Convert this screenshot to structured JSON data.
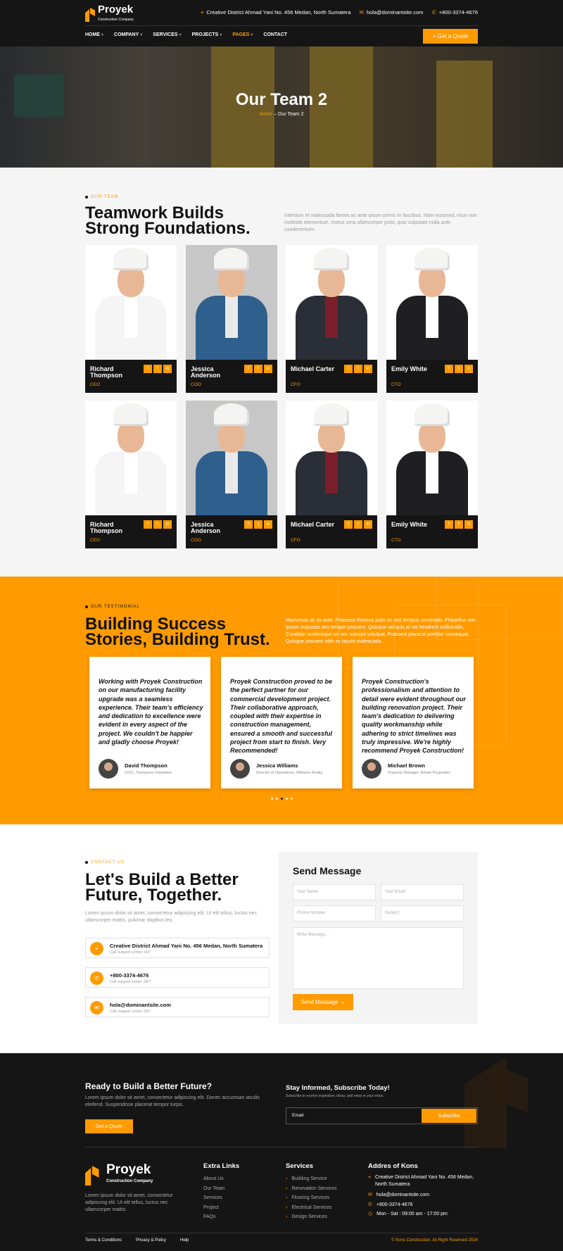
{
  "header": {
    "brand": "Proyek",
    "brand_sub": "Construction Company",
    "address": "Creative District Ahmad Yani No. 456 Medan, North Sumatera",
    "email": "hola@dominantsite.com",
    "phone": "+800-3374-4676",
    "quote_button": "+ Get a Quote",
    "nav": [
      {
        "label": "HOME",
        "caret": "▾"
      },
      {
        "label": "COMPANY",
        "caret": "▾"
      },
      {
        "label": "SERVICES",
        "caret": "▾"
      },
      {
        "label": "PROJECTS",
        "caret": "▾"
      },
      {
        "label": "PAGES",
        "caret": "▾"
      },
      {
        "label": "CONTACT",
        "caret": ""
      }
    ]
  },
  "hero": {
    "title": "Our Team 2",
    "crumb_home": "Home",
    "crumb_sep": " – ",
    "crumb_current": "Our Team 2"
  },
  "team": {
    "eyebrow": "OUR TEAM",
    "heading_1": "Teamwork Builds",
    "heading_2": "Strong Foundations.",
    "description": "Interdum et malesuada fames ac ante ipsum primis in faucibus. Nam euismod, risus non molestie elementum, metus urna ullamcorper justo, quis vulputate nulla ante condimentum.",
    "social": [
      "f",
      "t",
      "in"
    ],
    "members": [
      {
        "name": "Richard Thompson",
        "role": "CEO"
      },
      {
        "name": "Jessica Anderson",
        "role": "COO"
      },
      {
        "name": "Michael Carter",
        "role": "CFO"
      },
      {
        "name": "Emily White",
        "role": "CTO"
      },
      {
        "name": "Richard Thompson",
        "role": "CEO"
      },
      {
        "name": "Jessica Anderson",
        "role": "COO"
      },
      {
        "name": "Michael Carter",
        "role": "CFO"
      },
      {
        "name": "Emily White",
        "role": "CTO"
      }
    ]
  },
  "testimonials": {
    "eyebrow": "OUR TESTIMONIAL",
    "heading_1": "Building Success",
    "heading_2": "Stories, Building Trust.",
    "description": "Maecenas ac mi ante. Praesent rhoncus justo ac orci tempus commodo. Phasellus non ipsum vulputate orci tempor posuere. Quisque vel quis at vel hendrerit sollicitudin. Curabitur scelerisque mi nec suscipit volutpat. Praesent placerat porttitor consequat. Quisque posuere nibh ex iaculis malesuada.",
    "items": [
      {
        "quote": "Working with Proyek Construction on our manufacturing facility upgrade was a seamless experience. Their team's efficiency and dedication to excellence were evident in every aspect of the project. We couldn't be happier and gladly choose Proyek!",
        "name": "David Thompson",
        "role": "COO, Thompson Industries"
      },
      {
        "quote": "Proyek Construction proved to be the perfect partner for our commercial development project. Their collaborative approach, coupled with their expertise in construction management, ensured a smooth and successful project from start to finish. Very Recommended!",
        "name": "Jessica Williams",
        "role": "Director of Operations, Williams Realty"
      },
      {
        "quote": "Proyek Construction's professionalism and attention to detail were evident throughout our building renovation project. Their team's dedication to delivering quality workmanship while adhering to strict timelines was truly impressive. We're highly recommend Proyek Construction!",
        "name": "Michael Brown",
        "role": "Property Manager, Brown Properties"
      }
    ]
  },
  "contact": {
    "eyebrow": "CONTACT US",
    "heading_1": "Let's Build a Better",
    "heading_2": "Future, Together.",
    "description": "Lorem ipsum dolor sit amet, consectetur adipiscing elit. Ut elit tellus, luctus nec ullamcorper mattis, pulvinar dapibus leo.",
    "items": [
      {
        "icon": "map-pin-icon",
        "glyph": "⌖",
        "title": "Creative District Ahmad Yani No. 456 Medan, North Sumatera",
        "sub": "Call support center 24/7"
      },
      {
        "icon": "phone-icon",
        "glyph": "✆",
        "title": "+800-3374-4676",
        "sub": "Call support center 24/7"
      },
      {
        "icon": "mail-icon",
        "glyph": "✉",
        "title": "hola@dominantsite.com",
        "sub": "Call support center 24/7"
      }
    ],
    "form": {
      "title": "Send Message",
      "name_placeholder": "Your Name",
      "email_placeholder": "Your Email",
      "phone_placeholder": "Phone Number",
      "subject_placeholder": "Subject",
      "message_placeholder": "Write Message...",
      "submit": "Send Message →"
    }
  },
  "footer": {
    "cta_title": "Ready to Build a Better Future?",
    "cta_text": "Lorem ipsum dolor sit amet, consectetur adipiscing elit. Donec accumsan iaculis eleifend. Suspendisse placerat tempor turpis.",
    "cta_button": "Get a Quote",
    "subscribe_title": "Stay Informed, Subscribe Today!",
    "subscribe_text": "Subscribe to receive inspiration, ideas, and news in your inbox.",
    "email_placeholder": "Email",
    "subscribe_button": "Subscribe",
    "brand": "Proyek",
    "brand_sub": "Construction Company",
    "brand_text": "Lorem ipsum dolor sit amet, consectetur adipiscing elit. Ut elit tellus, luctus nec ullamcorper mattis.",
    "extra_title": "Extra Links",
    "extra_links": [
      "About Us",
      "Our Team",
      "Services",
      "Project",
      "FAQs"
    ],
    "services_title": "Services",
    "services": [
      "Building Service",
      "Renovation Services",
      "Flooring Services",
      "Electrical Services",
      "Design Services"
    ],
    "address_title": "Addres of Kons",
    "address_lines": [
      "Creative District Ahmad Yani No. 456 Medan,",
      "North Sumatera"
    ],
    "email": "hola@dominantsite.com",
    "phone": "+800-3374-4676",
    "hours": "Mon - Sat : 09:00 am - 17:00 pm",
    "bottom_links": [
      "Terms & Conditions",
      "Privacy & Policy",
      "Help"
    ],
    "copyright": "© Kons Construction. All Right Reserved 2024"
  },
  "colors": {
    "accent": "#ff9b00",
    "dark": "#151515"
  }
}
